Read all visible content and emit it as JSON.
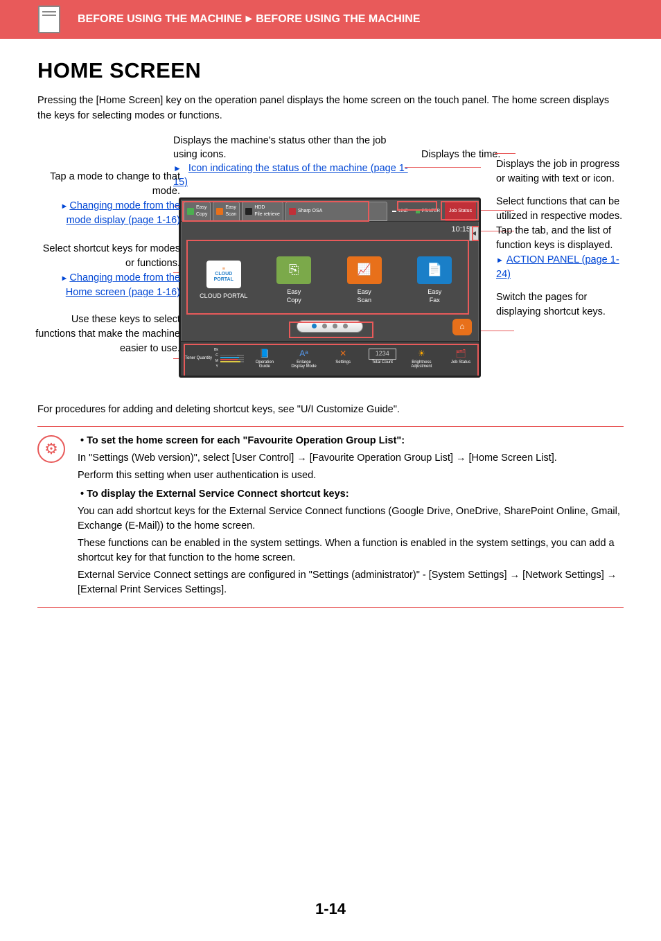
{
  "header": {
    "breadcrumb_a": "BEFORE USING THE MACHINE",
    "breadcrumb_sep": "►",
    "breadcrumb_b": "BEFORE USING THE MACHINE"
  },
  "title": "HOME SCREEN",
  "intro": "Pressing the [Home Screen] key on the operation panel displays the home screen on the touch panel. The home screen displays the keys for selecting modes or functions.",
  "above": {
    "status_icons": "Displays the machine's status other than the job using icons.",
    "time_label": "Displays the time.",
    "link_status_icons": "Icon indicating the status of the machine (page 1-15)"
  },
  "left": {
    "mode_tap": "Tap a mode to change to that mode.",
    "mode_link": "Changing mode from the mode display (page 1-16)",
    "shortcut": "Select shortcut keys for modes or functions.",
    "shortcut_link": "Changing mode from the Home screen (page 1-16)",
    "fnkeys": "Use these keys to select functions that make the machine easier to use."
  },
  "right": {
    "job": "Displays the job in progress or waiting with text or icon.",
    "functab": "Select functions that can be utilized in respective modes.\nTap the tab, and the list of function keys is displayed.",
    "functab_link": "ACTION PANEL (page 1-24)",
    "pager": "Switch the pages for displaying shortcut keys."
  },
  "panel": {
    "modes": [
      {
        "label": "Easy\nCopy"
      },
      {
        "label": "Easy\nScan"
      },
      {
        "label": "HDD\nFile retrieve"
      },
      {
        "label": "Sharp OSA"
      }
    ],
    "line_label": "LINE",
    "printer_label": "PRINTER",
    "job_status": "Job Status",
    "time": "10:15",
    "shortcuts": [
      {
        "name": "CLOUD PORTAL",
        "sub": "CLOUD\nPORTAL"
      },
      {
        "name": "Easy\nCopy"
      },
      {
        "name": "Easy\nScan"
      },
      {
        "name": "Easy\nFax"
      }
    ],
    "toner_label": "Toner Quantity",
    "toners": [
      "Bk",
      "C",
      "M",
      "Y"
    ],
    "fn_items": [
      "Operation\nGuide",
      "Enlarge\nDisplay Mode",
      "Settings",
      "Total Count",
      "Brightness\nAdjustment",
      "Job Status"
    ]
  },
  "procedures": "For procedures for adding and deleting shortcut keys, see \"U/I Customize Guide\".",
  "callout": {
    "bullet1_head": "• To set the home screen for each \"Favourite Operation Group List\":",
    "bullet1_body1": "In \"Settings (Web version)\", select [User Control] → [Favourite Operation Group List] → [Home Screen List].",
    "bullet1_body2": "Perform this setting when user authentication is used.",
    "bullet2_head": "• To display the External Service Connect shortcut keys:",
    "bullet2_body1": "You can add shortcut keys for the External Service Connect functions (Google Drive, OneDrive, SharePoint Online, Gmail, Exchange (E-Mail)) to the home screen.",
    "bullet2_body2": "These functions can be enabled in the system settings. When a function is enabled in the system settings, you can add a shortcut key for that function to the home screen.",
    "bullet2_body3": "External Service Connect settings are configured in \"Settings (administrator)\" - [System Settings] → [Network Settings] → [External Print Services Settings]."
  },
  "page_num": "1-14"
}
